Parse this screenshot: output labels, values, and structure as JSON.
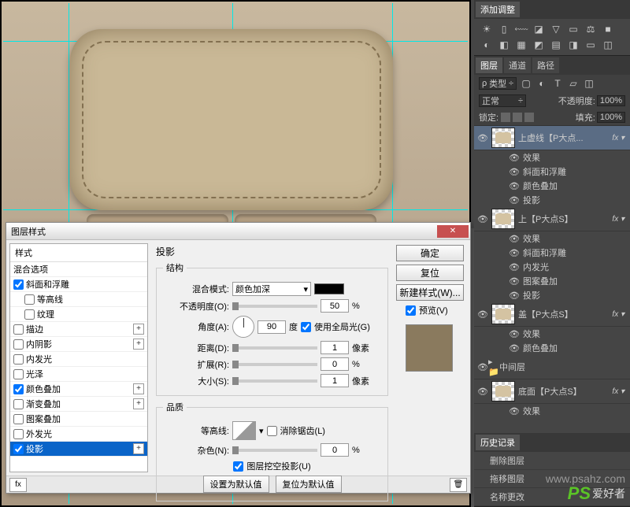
{
  "dialog": {
    "title": "图层样式",
    "styles_header": "样式",
    "blend_options": "混合选项",
    "styles": [
      {
        "label": "斜面和浮雕",
        "checked": true,
        "plus": false
      },
      {
        "label": "等高线",
        "checked": false,
        "plus": false,
        "indent": true
      },
      {
        "label": "纹理",
        "checked": false,
        "plus": false,
        "indent": true
      },
      {
        "label": "描边",
        "checked": false,
        "plus": true
      },
      {
        "label": "内阴影",
        "checked": false,
        "plus": true
      },
      {
        "label": "内发光",
        "checked": false,
        "plus": false
      },
      {
        "label": "光泽",
        "checked": false,
        "plus": false
      },
      {
        "label": "颜色叠加",
        "checked": true,
        "plus": true
      },
      {
        "label": "渐变叠加",
        "checked": false,
        "plus": true
      },
      {
        "label": "图案叠加",
        "checked": false,
        "plus": false
      },
      {
        "label": "外发光",
        "checked": false,
        "plus": false
      },
      {
        "label": "投影",
        "checked": true,
        "plus": true,
        "selected": true
      }
    ],
    "panel_title": "投影",
    "structure": "结构",
    "blend_mode_label": "混合模式:",
    "blend_mode_value": "颜色加深",
    "opacity_label": "不透明度(O):",
    "opacity_value": "50",
    "angle_label": "角度(A):",
    "angle_value": "90",
    "angle_unit": "度",
    "global_light": "使用全局光(G)",
    "distance_label": "距离(D):",
    "distance_value": "1",
    "distance_unit": "像素",
    "spread_label": "扩展(R):",
    "spread_value": "0",
    "spread_unit": "%",
    "size_label": "大小(S):",
    "size_value": "1",
    "size_unit": "像素",
    "quality": "品质",
    "contour_label": "等高线:",
    "antialias": "消除锯齿(L)",
    "noise_label": "杂色(N):",
    "noise_value": "0",
    "noise_unit": "%",
    "knockout": "图层挖空投影(U)",
    "make_default": "设置为默认值",
    "reset_default": "复位为默认值",
    "ok": "确定",
    "cancel": "复位",
    "new_style": "新建样式(W)...",
    "preview": "预览(V)"
  },
  "right": {
    "adjust_title": "添加调整",
    "panels": {
      "layers": "图层",
      "channels": "通道",
      "paths": "路径"
    },
    "kind": "类型",
    "mode": "正常",
    "opacity_label": "不透明度:",
    "opacity_value": "100%",
    "lock_label": "锁定:",
    "fill_label": "填充:",
    "fill_value": "100%",
    "layers": [
      {
        "name": "上虚线【P大点...",
        "fx": true,
        "selected": true,
        "effects": [
          "效果",
          "斜面和浮雕",
          "颜色叠加",
          "投影"
        ]
      },
      {
        "name": "上【P大点S】",
        "fx": true,
        "effects": [
          "效果",
          "斜面和浮雕",
          "内发光",
          "图案叠加",
          "投影"
        ]
      },
      {
        "name": "盖【P大点S】",
        "fx": true,
        "effects": [
          "效果",
          "颜色叠加"
        ]
      },
      {
        "name": "中间层",
        "folder": true
      },
      {
        "name": "底面【P大点S】",
        "fx": true,
        "effects": [
          "效果"
        ]
      }
    ],
    "history": "历史记录",
    "history_items": [
      "删除图层",
      "拖移图层",
      "名称更改"
    ]
  },
  "watermark": {
    "url": "www.psahz.com",
    "ps": "PS",
    "txt": "爱好者"
  }
}
